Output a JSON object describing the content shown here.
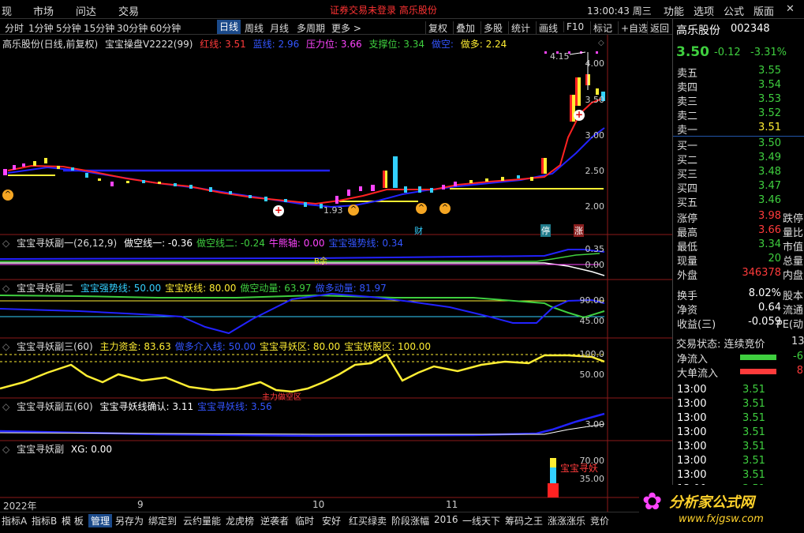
{
  "top_menu": {
    "items": [
      "现",
      "市场",
      "问达",
      "交易"
    ],
    "status": "证券交易未登录  高乐股份",
    "clock": "13:00:43 周三",
    "right_items": [
      "功能",
      "选项",
      "公式",
      "版面"
    ]
  },
  "period_bar": {
    "tabs": [
      "分时",
      "1分钟",
      "5分钟",
      "15分钟",
      "30分钟",
      "60分钟",
      "日线",
      "周线",
      "月线",
      "多周期",
      "更多 >"
    ],
    "active": "日线",
    "tools": [
      "复权",
      "叠加",
      "多股",
      "统计",
      "画线",
      "F10",
      "标记",
      "+自选",
      "返回"
    ]
  },
  "main_chart": {
    "title": "高乐股份(日线,前复权)",
    "indicator": "宝宝操盘V2222(99)",
    "params": [
      {
        "label": "红线: 3.51",
        "color": "#ff3b3b"
      },
      {
        "label": "蓝线: 2.96",
        "color": "#3355ff"
      },
      {
        "label": "压力位: 3.66",
        "color": "#ff44ff"
      },
      {
        "label": "支撑位: 3.34",
        "color": "#3fcf3f"
      },
      {
        "label": "做空: ",
        "color": "#3355ff"
      },
      {
        "label": "做多: 2.24",
        "color": "#ffee33"
      }
    ],
    "y_labels": [
      "4.00",
      "3.50",
      "3.00",
      "2.50",
      "2.00"
    ],
    "price_tags": [
      "4.15",
      "1.93"
    ],
    "event_marks": [
      "财",
      "停",
      "涨"
    ]
  },
  "sub1": {
    "title": "宝宝寻妖副一(26,12,9)",
    "params": [
      {
        "label": "做空线一: -0.36",
        "color": "#ffffff"
      },
      {
        "label": "做空线二: -0.24",
        "color": "#3fcf3f"
      },
      {
        "label": "牛熊轴: 0.00",
        "color": "#ff44ff"
      },
      {
        "label": "宝宝强势线: 0.34",
        "color": "#3355ff"
      }
    ],
    "y_labels": [
      "0.35",
      "0.00"
    ],
    "annotation": "B余"
  },
  "sub2": {
    "title": "宝宝寻妖副二",
    "params": [
      {
        "label": "宝宝强势线: 50.00",
        "color": "#33d0ff"
      },
      {
        "label": "宝宝妖线: 80.00",
        "color": "#ffee33"
      },
      {
        "label": "做空动量: 63.97",
        "color": "#3fcf3f"
      },
      {
        "label": "做多动量: 81.97",
        "color": "#3355ff"
      }
    ],
    "y_labels": [
      "90.00",
      "45.00"
    ]
  },
  "sub3": {
    "title": "宝宝寻妖副三(60)",
    "params": [
      {
        "label": "主力资金: 83.63",
        "color": "#ffee33"
      },
      {
        "label": "做多介入线: 50.00",
        "color": "#3355ff"
      },
      {
        "label": "宝宝寻妖区: 80.00",
        "color": "#ffee33"
      },
      {
        "label": "宝宝妖股区: 100.00",
        "color": "#ffee33"
      }
    ],
    "y_labels": [
      "100.0",
      "50.00"
    ],
    "annotation": "主力做空区"
  },
  "sub4": {
    "title": "宝宝寻妖副五(60)",
    "params": [
      {
        "label": "宝宝寻妖线确认: 3.11",
        "color": "#ffffff"
      },
      {
        "label": "宝宝寻妖线: 3.56",
        "color": "#3355ff"
      }
    ],
    "y_labels": [
      "3.00"
    ]
  },
  "sub5": {
    "title": "宝宝寻妖副",
    "params": [
      {
        "label": "XG: 0.00",
        "color": "#ffffff"
      }
    ],
    "y_labels": [
      "70.00",
      "35.00"
    ],
    "annotation": "宝宝寻妖"
  },
  "x_axis": [
    "2022年",
    "9",
    "10",
    "11"
  ],
  "quote": {
    "name": "高乐股份",
    "code": "002348",
    "price": "3.50",
    "change": "-0.12",
    "pct": "-3.31%",
    "asks": [
      {
        "label": "卖五",
        "price": "3.55"
      },
      {
        "label": "卖四",
        "price": "3.54"
      },
      {
        "label": "卖三",
        "price": "3.53"
      },
      {
        "label": "卖二",
        "price": "3.52"
      },
      {
        "label": "卖一",
        "price": "3.51"
      }
    ],
    "bids": [
      {
        "label": "买一",
        "price": "3.50"
      },
      {
        "label": "买二",
        "price": "3.49"
      },
      {
        "label": "买三",
        "price": "3.48"
      },
      {
        "label": "买四",
        "price": "3.47"
      },
      {
        "label": "买五",
        "price": "3.46"
      }
    ],
    "stats": [
      {
        "l": "涨停",
        "v": "3.98",
        "c": "red",
        "l2": "跌停"
      },
      {
        "l": "最高",
        "v": "3.66",
        "c": "red",
        "l2": "量比"
      },
      {
        "l": "最低",
        "v": "3.34",
        "c": "green",
        "l2": "市值"
      },
      {
        "l": "现量",
        "v": "20",
        "c": "green",
        "l2": "总量"
      },
      {
        "l": "外盘",
        "v": "346378",
        "c": "red",
        "l2": "内盘"
      }
    ],
    "stats2": [
      {
        "l": "换手",
        "v": "8.02%",
        "l2": "股本"
      },
      {
        "l": "净资",
        "v": "0.64",
        "l2": "流通"
      },
      {
        "l": "收益(三)",
        "v": "-0.059",
        "l2": "PE(动"
      }
    ],
    "trade_state": "交易状态: 连续竞价",
    "trade_state_tail": "13",
    "flows": [
      {
        "l": "净流入",
        "v": "-6",
        "c": "#3fcf3f"
      },
      {
        "l": "大单流入",
        "v": "8",
        "c": "#ff3b3b"
      }
    ],
    "ticks": [
      {
        "t": "13:00",
        "p": "3.51"
      },
      {
        "t": "13:00",
        "p": "3.51"
      },
      {
        "t": "13:00",
        "p": "3.51"
      },
      {
        "t": "13:00",
        "p": "3.51"
      },
      {
        "t": "13:00",
        "p": "3.51"
      },
      {
        "t": "13:00",
        "p": "3.51"
      },
      {
        "t": "13:00",
        "p": "3.51"
      },
      {
        "t": "13:00",
        "p": "3.51"
      }
    ]
  },
  "bottom_bar": {
    "items": [
      "指标A",
      "指标B",
      "模 板",
      "管理",
      "另存为",
      "绑定到",
      "云约量能",
      "龙虎榜",
      "逆袭者",
      "临时",
      "安好",
      "红买绿卖",
      "阶段涨幅",
      "2016",
      "一线天下",
      "筹码之王",
      "涨涨涨乐",
      "竞价"
    ],
    "active": "管理"
  },
  "logo": {
    "text": "分析家公式网",
    "url": "www.fxjgsw.com"
  },
  "watermark": "分析家公式网 www.fxjgsw.com"
}
